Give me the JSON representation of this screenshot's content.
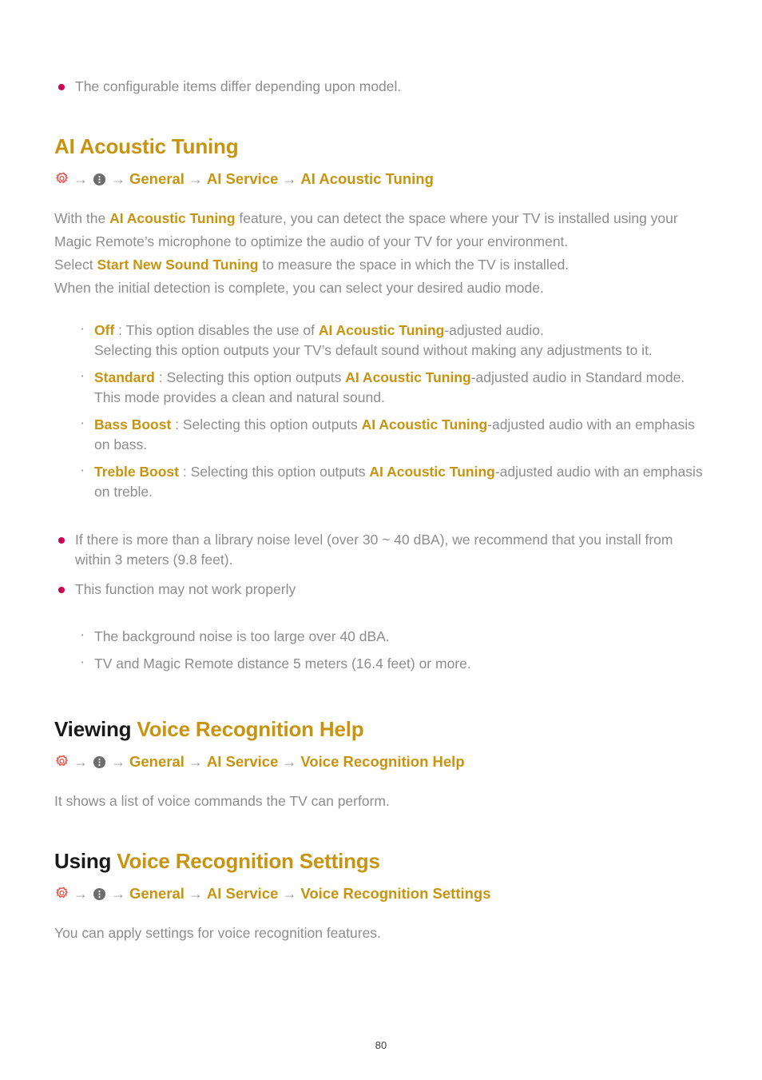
{
  "document": {
    "page_number": "80",
    "colors": {
      "accent_gold": "#c8940f",
      "bullet_crimson": "#cc0052",
      "body_gray": "#8d8d8d",
      "gear_icon_red": "#e8453c",
      "more_icon_gray": "#6d6d6d"
    }
  },
  "intro_note": {
    "text": "The configurable items differ depending upon model."
  },
  "sections": [
    {
      "id": "ai-acoustic-tuning",
      "heading_plain": "",
      "heading_accent": "AI Acoustic Tuning",
      "breadcrumb": {
        "gear_icon": "gear-icon",
        "more_icon": "more-options-icon",
        "arrow": "→",
        "items": [
          "General",
          "AI Service",
          "AI Acoustic Tuning"
        ]
      },
      "paragraph": {
        "line1_a": "With the ",
        "line1_hl": "AI Acoustic Tuning",
        "line1_b": " feature, you can detect the space where your TV is installed using your Magic Remote’s microphone to optimize the audio of your TV for your environment.",
        "line2_a": "Select ",
        "line2_hl": "Start New Sound Tuning",
        "line2_b": " to measure the space in which the TV is installed.",
        "line3": "When the initial detection is complete, you can select your desired audio mode."
      },
      "options": [
        {
          "name": "Off",
          "sep": " : ",
          "desc_a": "This option disables the use of ",
          "desc_hl": "AI Acoustic Tuning",
          "desc_b": "-adjusted audio.",
          "extra": "Selecting this option outputs your TV’s default sound without making any adjustments to it."
        },
        {
          "name": "Standard",
          "sep": " : ",
          "desc_a": "Selecting this option outputs ",
          "desc_hl": "AI Acoustic Tuning",
          "desc_b": "-adjusted audio in Standard mode.",
          "extra": "This mode provides a clean and natural sound."
        },
        {
          "name": "Bass Boost",
          "sep": " : ",
          "desc_a": "Selecting this option outputs ",
          "desc_hl": "AI Acoustic Tuning",
          "desc_b": "-adjusted audio with an emphasis on bass.",
          "extra": ""
        },
        {
          "name": "Treble Boost",
          "sep": " : ",
          "desc_a": "Selecting this option outputs ",
          "desc_hl": "AI Acoustic Tuning",
          "desc_b": "-adjusted audio with an emphasis on treble.",
          "extra": ""
        }
      ],
      "notes": [
        "If there is more than a library noise level (over 30 ~ 40 dBA), we recommend that you install from within 3 meters (9.8 feet).",
        "This function may not work properly"
      ],
      "sub_notes": [
        "The background noise is too large over 40 dBA.",
        "TV and Magic Remote distance 5 meters (16.4 feet) or more."
      ]
    },
    {
      "id": "viewing-voice-recognition-help",
      "heading_plain": "Viewing ",
      "heading_accent": "Voice Recognition Help",
      "breadcrumb": {
        "items": [
          "General",
          "AI Service",
          "Voice Recognition Help"
        ]
      },
      "paragraph": {
        "line1": "It shows a list of voice commands the TV can perform."
      }
    },
    {
      "id": "using-voice-recognition-settings",
      "heading_plain": "Using ",
      "heading_accent": "Voice Recognition Settings",
      "breadcrumb": {
        "items": [
          "General",
          "AI Service",
          "Voice Recognition Settings"
        ]
      },
      "paragraph": {
        "line1": "You can apply settings for voice recognition features."
      }
    }
  ]
}
